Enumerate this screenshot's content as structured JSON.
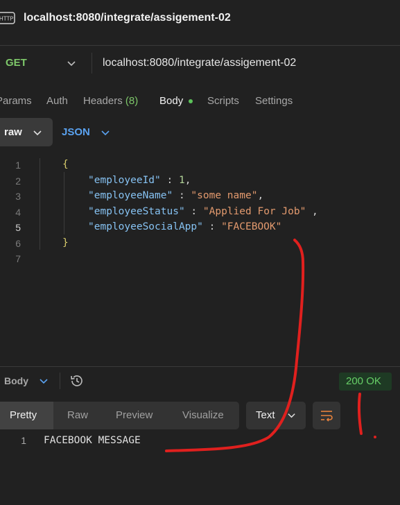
{
  "window": {
    "title": "localhost:8080/integrate/assigement-02",
    "icon": "http-icon"
  },
  "request": {
    "method": "GET",
    "url": "localhost:8080/integrate/assigement-02"
  },
  "tabs": [
    {
      "label": "Params"
    },
    {
      "label": "Auth"
    },
    {
      "label": "Headers",
      "count": "(8)"
    },
    {
      "label": "Body",
      "active": true
    },
    {
      "label": "Scripts"
    },
    {
      "label": "Settings"
    }
  ],
  "body_mode": {
    "type": "raw",
    "format": "JSON"
  },
  "editor": {
    "line_numbers": [
      "1",
      "2",
      "3",
      "4",
      "5",
      "6",
      "7"
    ],
    "lines": [
      {
        "open": "{"
      },
      {
        "key": "\"employeeId\"",
        "sep": " : ",
        "value": "1",
        "tail": ","
      },
      {
        "key": "\"employeeName\"",
        "sep": " : ",
        "value": "\"some name\"",
        "tail": ","
      },
      {
        "key": "\"employeeStatus\"",
        "sep": " : ",
        "value": "\"Applied For Job\"",
        "tail": " ,"
      },
      {
        "key": "\"employeeSocialApp\"",
        "sep": " : ",
        "value": "\"FACEBOOK\"",
        "tail": ""
      },
      {
        "close": "}"
      }
    ]
  },
  "response": {
    "section_label": "Body",
    "status": "200 OK",
    "view_tabs": [
      "Pretty",
      "Raw",
      "Preview",
      "Visualize"
    ],
    "active_view": "Pretty",
    "format": "Text",
    "line_number": "1",
    "content": "FACEBOOK MESSAGE"
  },
  "colors": {
    "accent_green": "#7ec86a",
    "json_blue": "#5aa2f0",
    "status_green": "#67cf67",
    "annotation_red": "#e0201e"
  }
}
